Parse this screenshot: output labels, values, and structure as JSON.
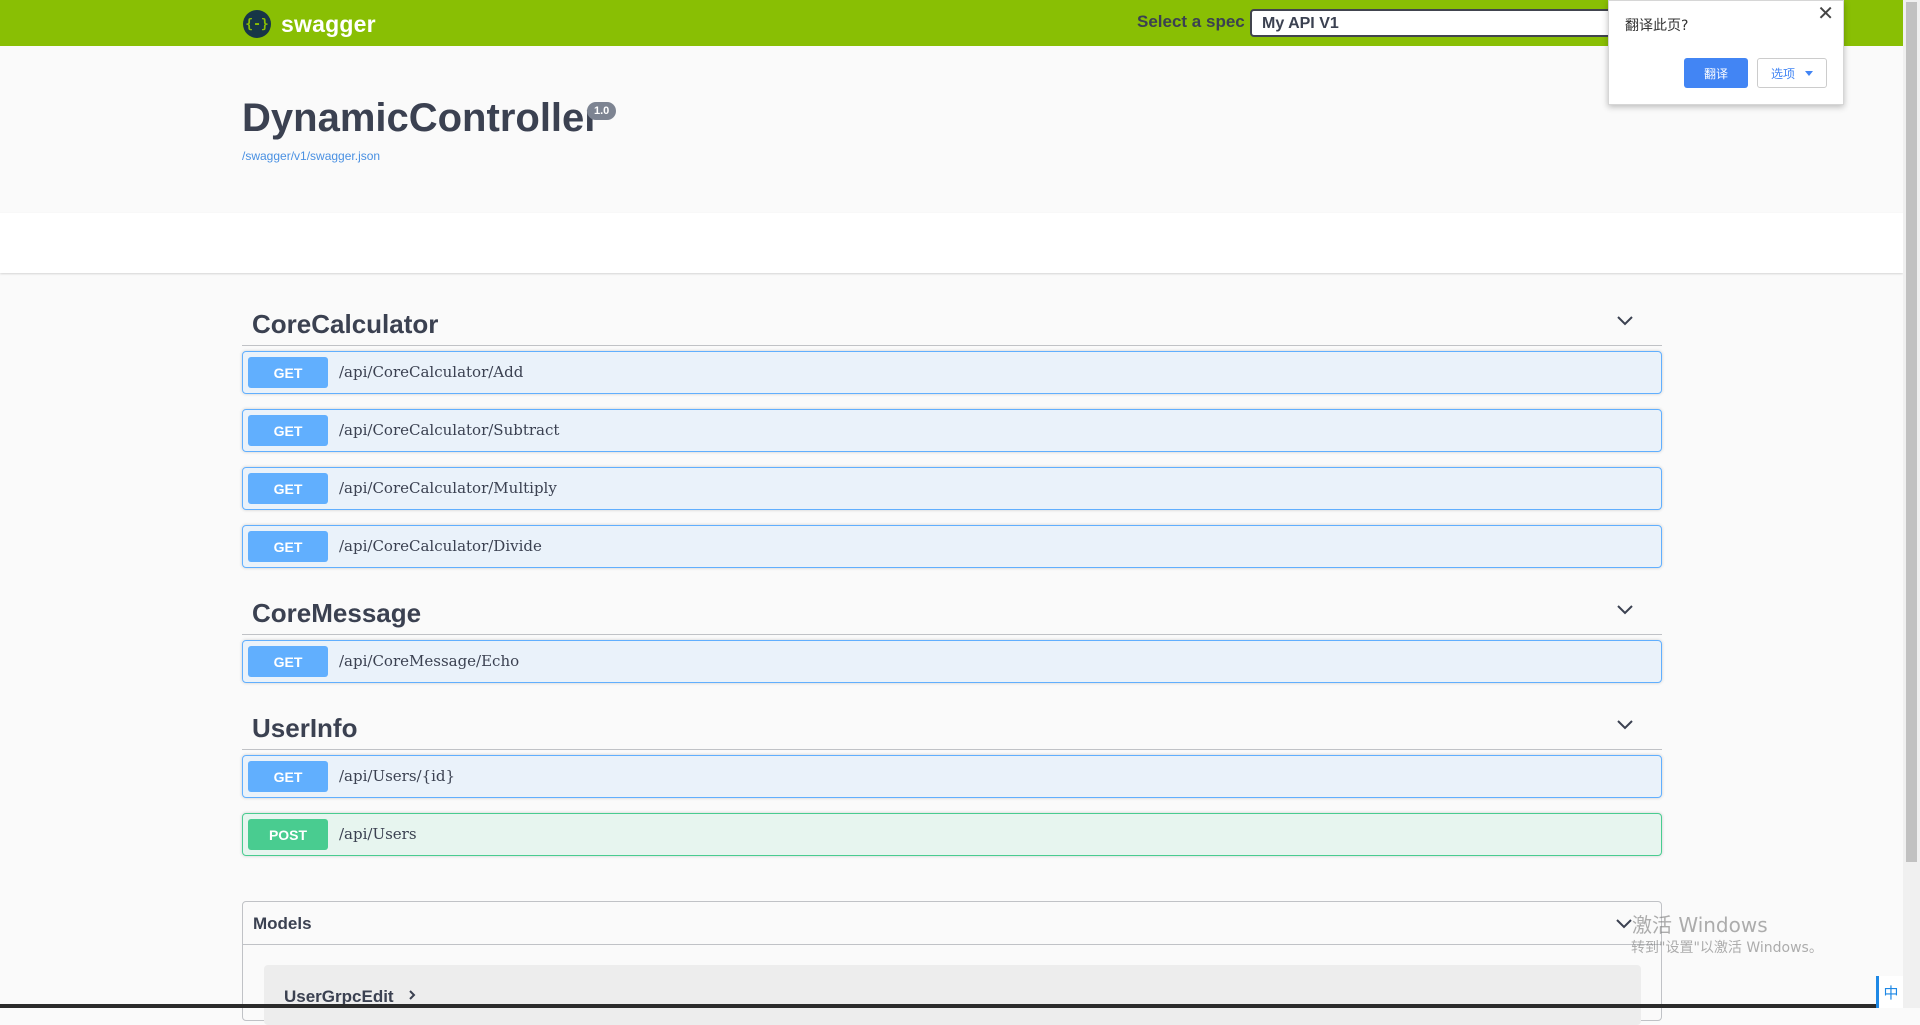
{
  "topbar": {
    "logo_mark": "{-}",
    "logo_text": "swagger",
    "spec_label": "Select a spec",
    "spec_selected": "My API V1"
  },
  "translate_popup": {
    "title": "翻译此页?",
    "close": "✕",
    "translate_button": "翻译",
    "options_button": "选项"
  },
  "info": {
    "title": "DynamicController",
    "version": "1.0",
    "spec_url": "/swagger/v1/swagger.json"
  },
  "tags": [
    {
      "name": "CoreCalculator",
      "operations": [
        {
          "method": "GET",
          "path": "/api/CoreCalculator/Add"
        },
        {
          "method": "GET",
          "path": "/api/CoreCalculator/Subtract"
        },
        {
          "method": "GET",
          "path": "/api/CoreCalculator/Multiply"
        },
        {
          "method": "GET",
          "path": "/api/CoreCalculator/Divide"
        }
      ]
    },
    {
      "name": "CoreMessage",
      "operations": [
        {
          "method": "GET",
          "path": "/api/CoreMessage/Echo"
        }
      ]
    },
    {
      "name": "UserInfo",
      "operations": [
        {
          "method": "GET",
          "path": "/api/Users/{id}"
        },
        {
          "method": "POST",
          "path": "/api/Users"
        }
      ]
    }
  ],
  "models": {
    "title": "Models",
    "items": [
      "UserGrpcEdit"
    ]
  },
  "watermark": {
    "line1": "激活 Windows",
    "line2": "转到\"设置\"以激活 Windows。"
  },
  "ime_indicator": "中",
  "colors": {
    "topbar": "#89bf04",
    "get": "#61affe",
    "post": "#49cc90",
    "translate_button": "#4285f4"
  }
}
